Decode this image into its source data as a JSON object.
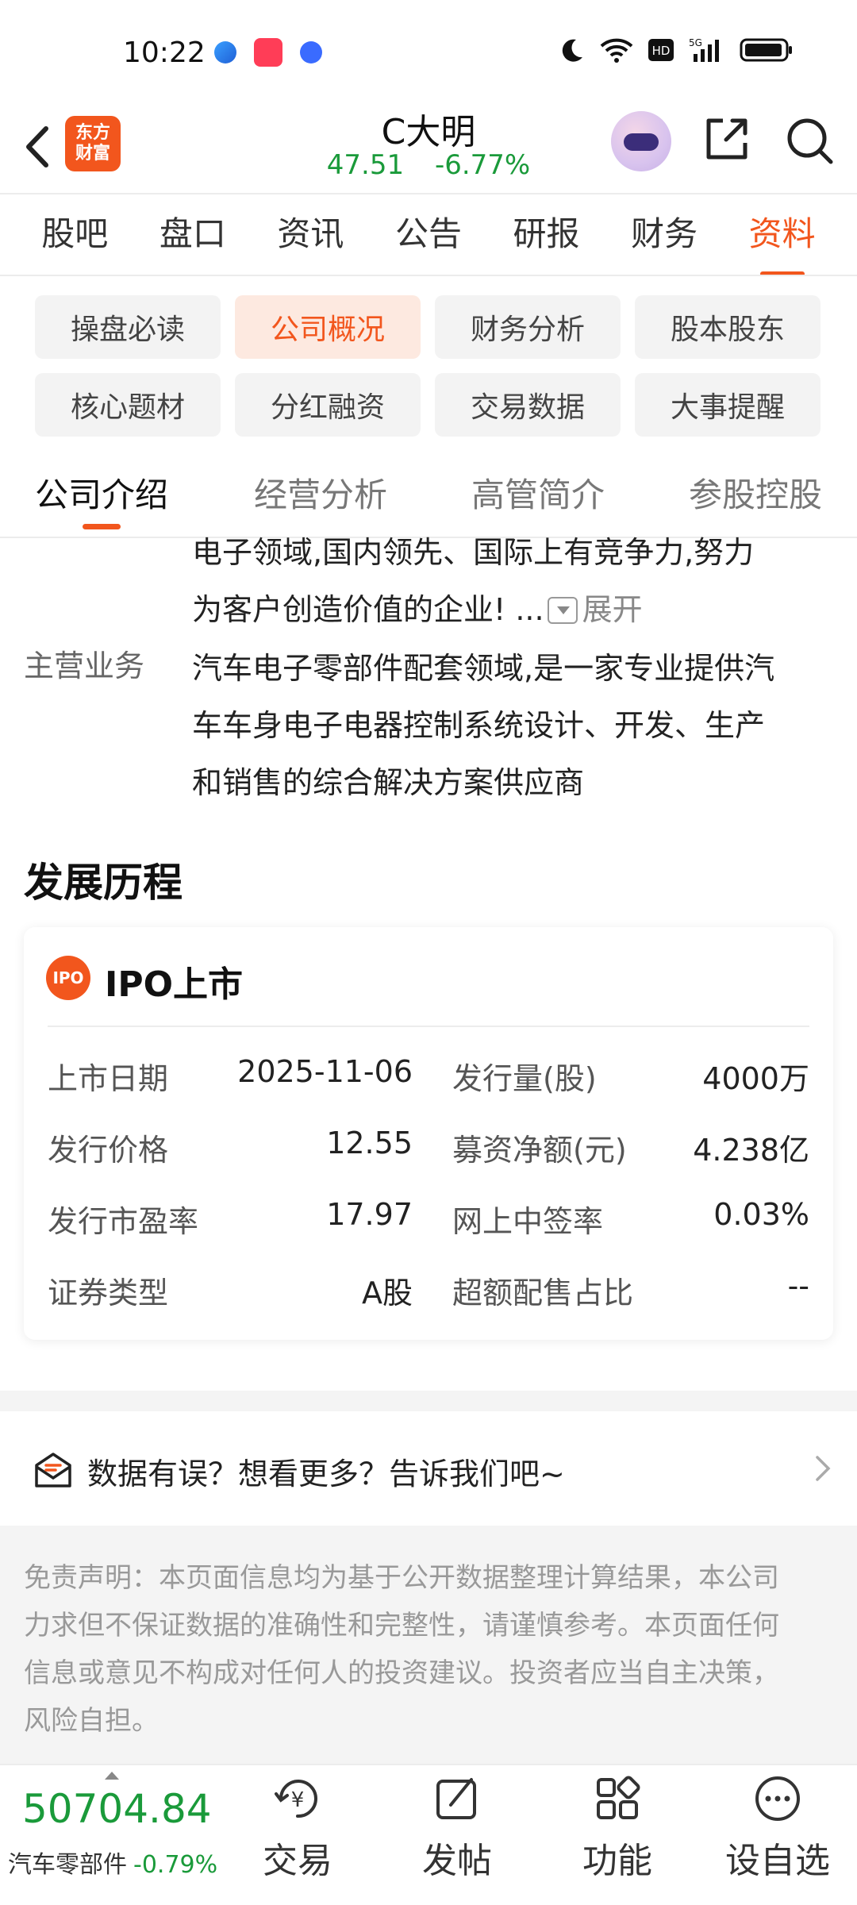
{
  "status_bar": {
    "time": "10:22"
  },
  "header": {
    "logo_line1": "东方",
    "logo_line2": "财富",
    "stock_name": "C大明",
    "price": "47.51",
    "change_pct": "-6.77%"
  },
  "main_tabs": [
    {
      "label": "股吧"
    },
    {
      "label": "盘口"
    },
    {
      "label": "资讯"
    },
    {
      "label": "公告"
    },
    {
      "label": "研报"
    },
    {
      "label": "财务"
    },
    {
      "label": "资料"
    }
  ],
  "chips": [
    {
      "label": "操盘必读"
    },
    {
      "label": "公司概况"
    },
    {
      "label": "财务分析"
    },
    {
      "label": "股本股东"
    },
    {
      "label": "核心题材"
    },
    {
      "label": "分红融资"
    },
    {
      "label": "交易数据"
    },
    {
      "label": "大事提醒"
    }
  ],
  "sub_tabs": [
    {
      "label": "公司介绍"
    },
    {
      "label": "经营分析"
    },
    {
      "label": "高管简介"
    },
    {
      "label": "参股控股"
    }
  ],
  "intro": {
    "line1": "电子领域,国内领先、国际上有竞争力,努力",
    "line2": "为客户创造价值的企业! ...",
    "expand_label": "展开"
  },
  "main_business": {
    "label": "主营业务",
    "line1": "汽车电子零部件配套领域,是一家专业提供汽",
    "line2": "车车身电子电器控制系统设计、开发、生产",
    "line3": "和销售的综合解决方案供应商"
  },
  "history": {
    "title": "发展历程",
    "card_badge": "IPO",
    "card_title": "IPO上市",
    "rows": [
      {
        "k1": "上市日期",
        "v1": "2025-11-06",
        "k2": "发行量(股)",
        "v2": "4000万"
      },
      {
        "k1": "发行价格",
        "v1": "12.55",
        "k2": "募资净额(元)",
        "v2": "4.238亿"
      },
      {
        "k1": "发行市盈率",
        "v1": "17.97",
        "k2": "网上中签率",
        "v2": "0.03%"
      },
      {
        "k1": "证券类型",
        "v1": "A股",
        "k2": "超额配售占比",
        "v2": "--"
      }
    ]
  },
  "feedback": {
    "text": "数据有误？想看更多？告诉我们吧~"
  },
  "disclaimer": {
    "line1": "免责声明：本页面信息均为基于公开数据整理计算结果，本公司",
    "line2": "力求但不保证数据的准确性和完整性，请谨慎参考。本页面任何",
    "line3": "信息或意见不构成对任何人的投资建议。投资者应当自主决策，",
    "line4": "风险自担。"
  },
  "bottom_bar": {
    "index_value": "50704.84",
    "index_name": "汽车零部件",
    "index_pct": "-0.79%",
    "nav": [
      {
        "label": "交易",
        "icon": "trade-icon"
      },
      {
        "label": "发帖",
        "icon": "post-icon"
      },
      {
        "label": "功能",
        "icon": "grid-icon"
      },
      {
        "label": "设自选",
        "icon": "more-icon"
      }
    ]
  },
  "colors": {
    "accent": "#f2561d",
    "down": "#1a9a3a"
  }
}
